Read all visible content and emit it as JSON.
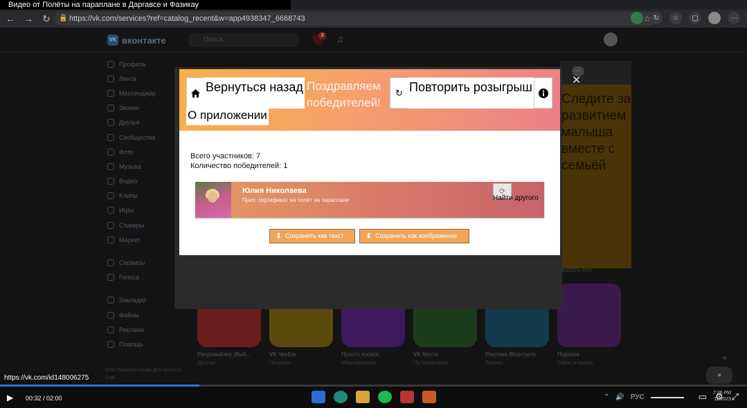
{
  "video_title": "Видео от Полёты на параплане в Даргавсе и Фазикау",
  "browser": {
    "url": "https://vk.com/services?ref=catalog_recent&w=app4938347_6668743",
    "status_url": "https://vk.com/id148006275"
  },
  "vk": {
    "logo_text": "вконтакте",
    "search_placeholder": "Поиск",
    "notifications_count": "3",
    "sidebar_group1": [
      "Профиль",
      "Лента",
      "Мессенджер",
      "Звонки",
      "Друзья",
      "Сообщества",
      "Фото",
      "Музыка",
      "Видео",
      "Клипы",
      "Игры",
      "Стикеры",
      "Маркет"
    ],
    "sidebar_group2": [
      "Сервисы",
      "Голоса"
    ],
    "sidebar_group3": [
      "Закладки",
      "Файлы",
      "Реклама",
      "Помощь"
    ],
    "footer": "Блог Разработчикам Для бизнеса Ещё",
    "ad_text": "Следите за развитием малыша вместе с семьёй",
    "more_link": "Показать все",
    "apps": [
      {
        "name": "Рандомайзер (Выб...",
        "sub": "Другое",
        "color": "#6b1d1d"
      },
      {
        "name": "VK Чекбэк",
        "sub": "Покупки",
        "color": "#5a4a0e"
      },
      {
        "name": "Просто космос",
        "sub": "Мероприятия",
        "color": "#3c1a5c"
      },
      {
        "name": "VK Места",
        "sub": "Путешествия",
        "color": "#1c3d1c"
      },
      {
        "name": "Реклама ВКонтакте",
        "sub": "Бизнес",
        "color": "#123a4a"
      },
      {
        "name": "Подарки",
        "sub": "Офис и жизнь",
        "color": "#3a1a4a"
      }
    ]
  },
  "modal": {
    "back_label": "Вернуться назад",
    "title": "Поздравляем победителей!",
    "repeat_label": "Повторить розыгрыш",
    "about_label": "О приложении",
    "participants_label": "Всего участников: 7",
    "winners_label": "Количество победителей: 1",
    "winner": {
      "name": "Юлия Николаева",
      "prize": "Приз: сертификат на полёт на параплане",
      "find_label": "Найти другого"
    },
    "save_text_label": "Сохранить как текст",
    "save_image_label": "Сохранить как изображение"
  },
  "player": {
    "timecode": "00:32 / 02:00",
    "progress": 0.267,
    "lang": "РУС",
    "clock_time": "7:36 PM",
    "clock_date": "11/2023"
  }
}
